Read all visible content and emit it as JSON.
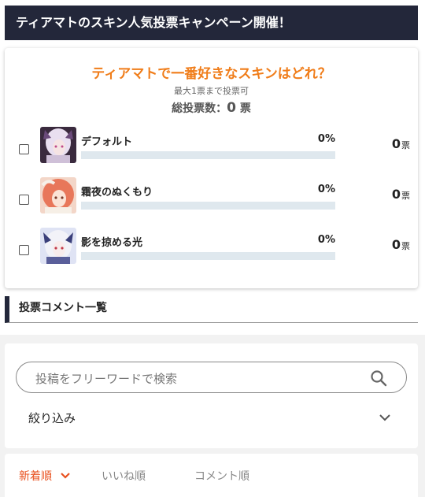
{
  "header": {
    "title": "ティアマトのスキン人気投票キャンペーン開催！"
  },
  "poll": {
    "question": "ティアマトで一番好きなスキンはどれ？",
    "note": "最大1票まで投票可",
    "total_label": "総投票数：",
    "total_value": "0",
    "total_unit": "票",
    "options": [
      {
        "name": "デフォルト",
        "percent": "0%",
        "fill": 0,
        "votes": "0",
        "unit": "票"
      },
      {
        "name": "霜夜のぬくもり",
        "percent": "0%",
        "fill": 0,
        "votes": "0",
        "unit": "票"
      },
      {
        "name": "影を掠める光",
        "percent": "0%",
        "fill": 0,
        "votes": "0",
        "unit": "票"
      }
    ]
  },
  "comments": {
    "heading": "投票コメント一覧"
  },
  "search": {
    "placeholder": "投稿をフリーワードで検索",
    "filter_label": "絞り込み"
  },
  "sort": {
    "tabs": [
      "新着順",
      "いいね順",
      "コメント順"
    ],
    "active_index": 0
  },
  "colors": {
    "accent": "#f07d1a",
    "dark": "#23273a",
    "sort_active": "#e8501e"
  }
}
